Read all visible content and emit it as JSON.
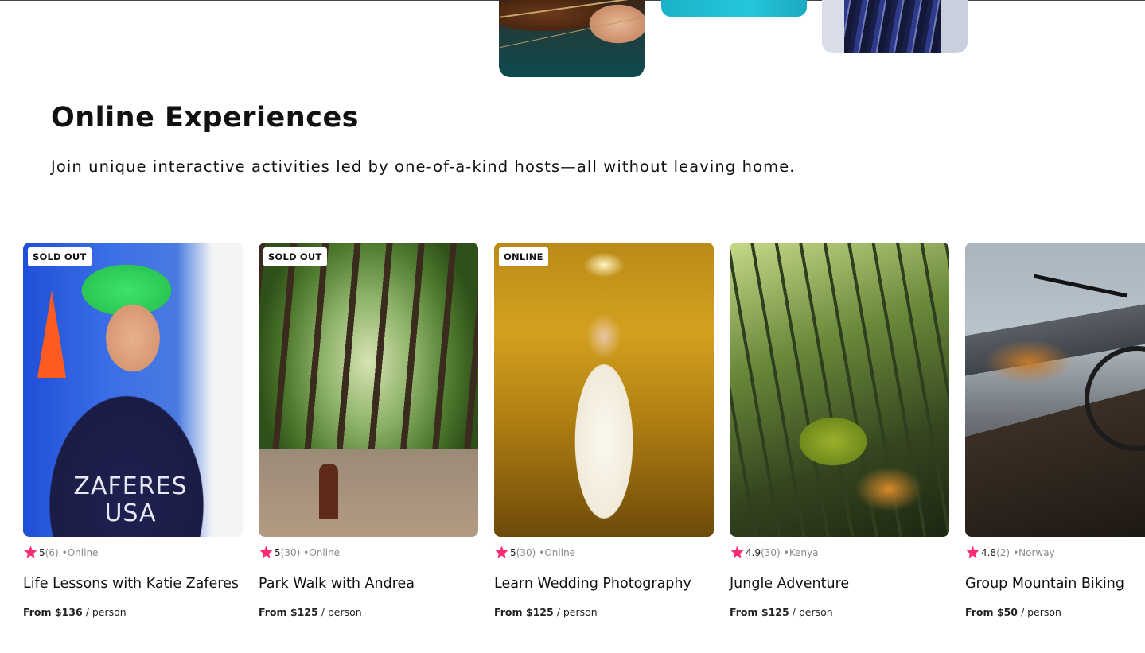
{
  "section": {
    "title": "Online Experiences",
    "subtitle": "Join unique interactive activities led by one-of-a-kind hosts—all without leaving home."
  },
  "colors": {
    "star": "#fe2d72",
    "text": "#111111",
    "muted": "#8a8a8a"
  },
  "cards": [
    {
      "badge": "SOLD OUT",
      "rating": "5",
      "count": "(6)",
      "location": "•Online",
      "title": "Life Lessons with Katie Zaferes",
      "price": "From $136",
      "unit": " / person",
      "photo_text": "ZAFERES\nUSA"
    },
    {
      "badge": "SOLD OUT",
      "rating": "5",
      "count": "(30)",
      "location": "•Online",
      "title": "Park Walk with Andrea",
      "price": "From $125",
      "unit": " / person"
    },
    {
      "badge": "ONLINE",
      "rating": "5",
      "count": "(30)",
      "location": "•Online",
      "title": "Learn Wedding Photography",
      "price": "From $125",
      "unit": " / person"
    },
    {
      "badge": "",
      "rating": "4.9",
      "count": "(30)",
      "location": "•Kenya",
      "title": "Jungle Adventure",
      "price": "From $125",
      "unit": " / person"
    },
    {
      "badge": "",
      "rating": "4.8",
      "count": "(2)",
      "location": "•Norway",
      "title": "Group Mountain Biking",
      "price": "From $50",
      "unit": " / person"
    }
  ]
}
